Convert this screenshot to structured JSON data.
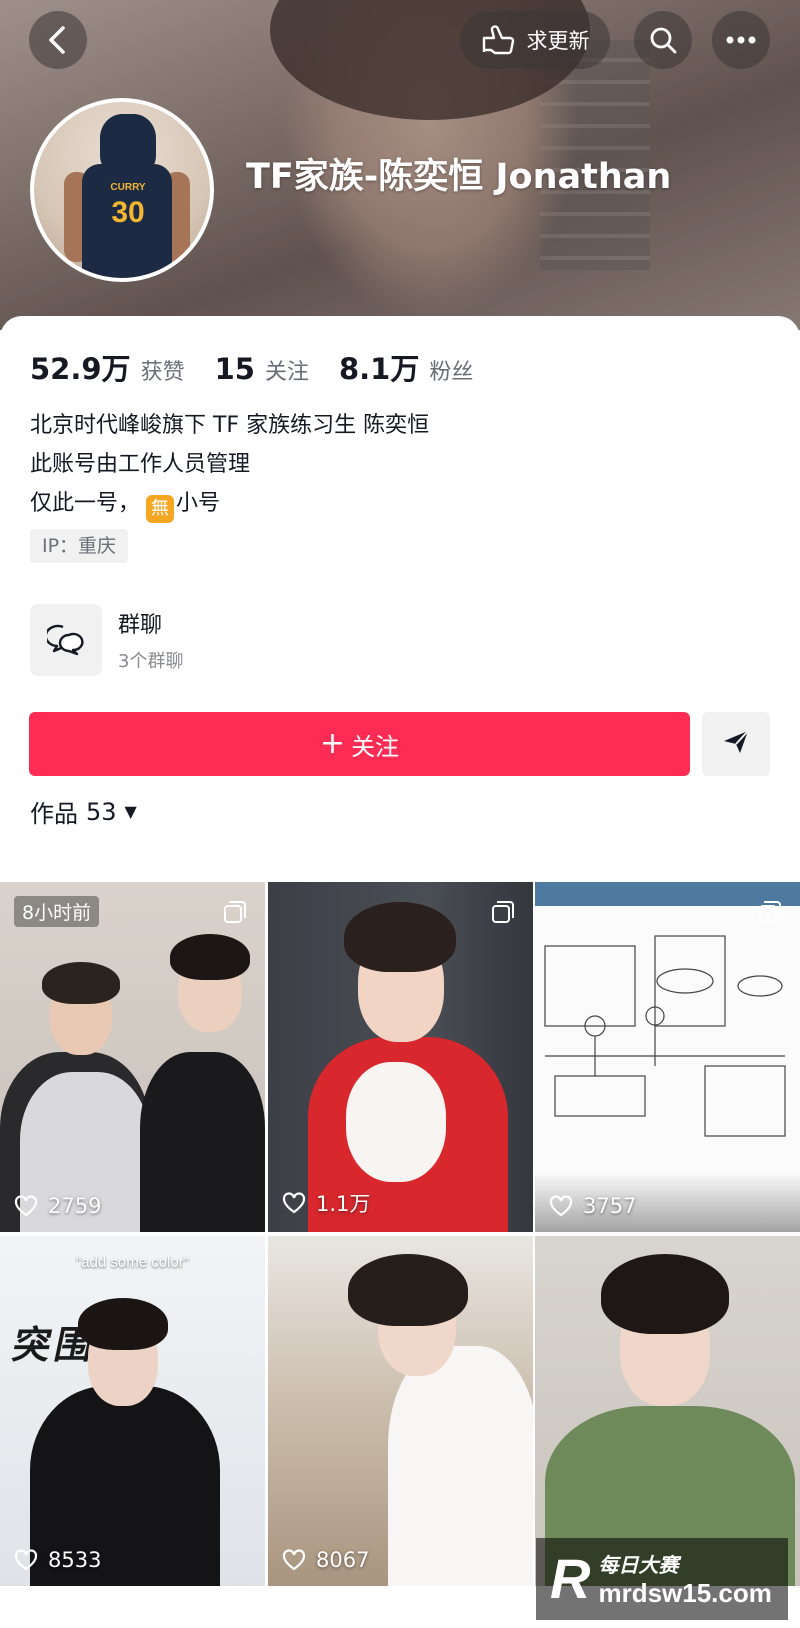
{
  "header": {
    "update_label": "求更新",
    "nickname": "TF家族-陈奕恒 Jonathan",
    "avatar_jersey_name": "CURRY",
    "avatar_jersey_number": "30"
  },
  "stats": [
    {
      "num": "52.9万",
      "label": "获赞"
    },
    {
      "num": "15",
      "label": "关注"
    },
    {
      "num": "8.1万",
      "label": "粉丝"
    }
  ],
  "bio": {
    "line1": "北京时代峰峻旗下 TF 家族练习生 陈奕恒",
    "line2": "此账号由工作人员管理",
    "line3_prefix": "仅此一号，",
    "line3_badge": "無",
    "line3_suffix": "小号"
  },
  "ip_tag": "IP：重庆",
  "group_chat": {
    "title": "群聊",
    "subtitle": "3个群聊"
  },
  "follow_button": {
    "plus": "+",
    "label": "关注"
  },
  "works_tab": {
    "label": "作品",
    "count": "53",
    "caret": "▼"
  },
  "videos": [
    {
      "likes": "2759",
      "time_tag": "8小时前",
      "multi": true
    },
    {
      "likes": "1.1万",
      "multi": true
    },
    {
      "likes": "3757",
      "multi": true
    },
    {
      "likes": "8533",
      "caption": "\"add some color\"",
      "wall_text": "突围 局"
    },
    {
      "likes": "8067"
    },
    {
      "likes": ""
    }
  ],
  "watermark": {
    "logo": "R",
    "line1": "每日大赛",
    "line2": "mrdsw15.com"
  },
  "colors": {
    "accent": "#fe2c55",
    "text_primary": "#161823",
    "text_secondary": "#6b6d77"
  }
}
